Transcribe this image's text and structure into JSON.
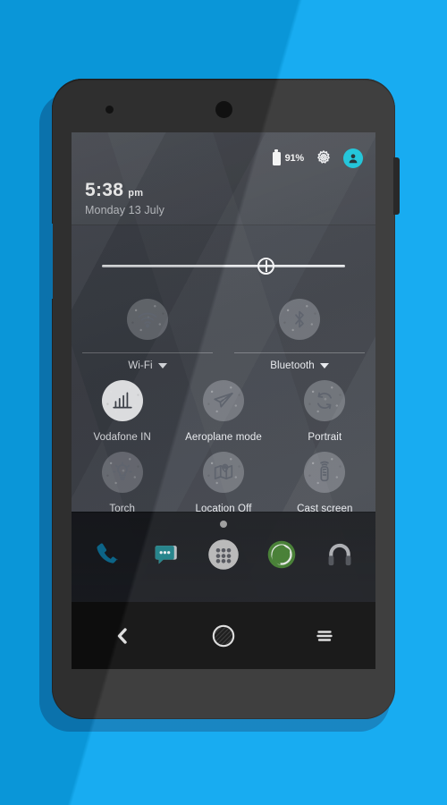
{
  "theme": {
    "background_color": "#0ba7f0",
    "shadow_color": "#0c7fbf",
    "phone_body_color": "#343434",
    "accent_cyan": "#18c3d8",
    "screen_slate": "#42464e",
    "label_color": "#e8eaee"
  },
  "status_bar": {
    "battery_icon": "battery-icon",
    "battery_percent": "91%",
    "settings_icon": "gear-icon",
    "user_icon": "user-avatar-icon"
  },
  "clock": {
    "time": "5:38",
    "meridiem": "pm",
    "date": "Monday 13 July"
  },
  "brightness": {
    "label": "brightness-slider",
    "value_percent": 64,
    "thumb_icon": "brightness-thumb-icon"
  },
  "quick_settings": {
    "rows": [
      {
        "columns": 2,
        "tiles": [
          {
            "label": "Wi-Fi",
            "icon": "wifi-icon",
            "active": false,
            "has_caret": true,
            "has_divider": true
          },
          {
            "label": "Bluetooth",
            "icon": "bluetooth-icon",
            "active": false,
            "has_caret": true,
            "has_divider": true
          }
        ]
      },
      {
        "columns": 3,
        "tiles": [
          {
            "label": "Vodafone IN",
            "icon": "cell-signal-icon",
            "active": true,
            "has_caret": false,
            "has_divider": false
          },
          {
            "label": "Aeroplane mode",
            "icon": "airplane-icon",
            "active": false,
            "has_caret": false,
            "has_divider": false
          },
          {
            "label": "Portrait",
            "icon": "rotate-icon",
            "active": false,
            "has_caret": false,
            "has_divider": false
          }
        ]
      },
      {
        "columns": 3,
        "tiles": [
          {
            "label": "Torch",
            "icon": "flashlight-icon",
            "active": false,
            "has_caret": false,
            "has_divider": false
          },
          {
            "label": "Location Off",
            "icon": "location-map-icon",
            "active": false,
            "has_caret": false,
            "has_divider": false
          },
          {
            "label": "Cast screen",
            "icon": "cast-remote-icon",
            "active": false,
            "has_caret": false,
            "has_divider": false
          }
        ]
      }
    ]
  },
  "dock": {
    "page_indicator": "page-indicator-dot",
    "items": [
      {
        "name": "phone-app",
        "icon": "phone-handset-icon",
        "color": "#0d6f96"
      },
      {
        "name": "messaging-app",
        "icon": "message-bubble-icon",
        "color": "#1b7e85"
      },
      {
        "name": "app-drawer",
        "icon": "app-drawer-icon",
        "color": "#b6b6b6"
      },
      {
        "name": "browser-app",
        "icon": "globe-icon",
        "color": "#3f7a2d"
      },
      {
        "name": "music-app",
        "icon": "headphones-icon",
        "color": "#a9abb0"
      }
    ]
  },
  "nav_bar": {
    "buttons": [
      {
        "name": "back-button",
        "icon": "back-chevron-icon"
      },
      {
        "name": "home-button",
        "icon": "home-circle-icon"
      },
      {
        "name": "recents-button",
        "icon": "recents-lines-icon"
      }
    ]
  },
  "hardware": {
    "power_button": "power-button",
    "volume_button": "volume-button",
    "front_camera": "front-camera",
    "proximity_sensor": "proximity-sensor"
  }
}
